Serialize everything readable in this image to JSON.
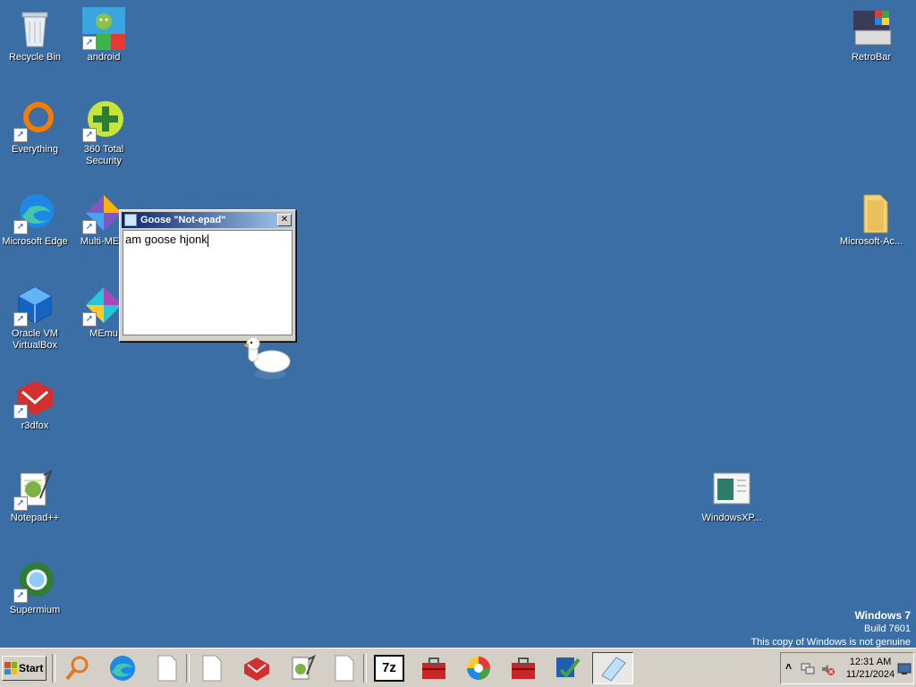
{
  "desktop": {
    "icons": [
      {
        "label": "Recycle Bin",
        "icon": "recycle-bin-icon"
      },
      {
        "label": "android",
        "icon": "android-icon"
      },
      {
        "label": "RetroBar",
        "icon": "retrobar-icon"
      },
      {
        "label": "Everything",
        "icon": "everything-icon"
      },
      {
        "label": "360 Total Security",
        "icon": "360-security-icon"
      },
      {
        "label": "Microsoft Edge",
        "icon": "edge-icon"
      },
      {
        "label": "Multi-ME...",
        "icon": "multi-memu-icon"
      },
      {
        "label": "Microsoft-Ac...",
        "icon": "folder-icon"
      },
      {
        "label": "Oracle VM VirtualBox",
        "icon": "virtualbox-icon"
      },
      {
        "label": "MEmu",
        "icon": "memu-icon"
      },
      {
        "label": "r3dfox",
        "icon": "r3dfox-icon"
      },
      {
        "label": "Notepad++",
        "icon": "notepadpp-icon"
      },
      {
        "label": "WindowsXP...",
        "icon": "windowsxp-file-icon"
      },
      {
        "label": "Supermium",
        "icon": "supermium-icon"
      }
    ]
  },
  "notepad": {
    "title": "Goose \"Not-epad\"",
    "text": "am goose hjonk",
    "close_glyph": "✕"
  },
  "watermark": {
    "line1": "Windows 7",
    "line2": "Build 7601",
    "line3": "This copy of Windows is not genuine"
  },
  "taskbar": {
    "start_label": "Start",
    "buttons": [
      "search-icon",
      "edge-icon",
      "blank-doc-icon",
      "blank-doc-icon",
      "r3dfox-icon",
      "notepadpp-icon",
      "blank-doc-icon",
      "7zip-icon",
      "toolbox-icon",
      "photos-icon",
      "toolbox-icon",
      "checklist-icon",
      "notepad-icon"
    ],
    "sevenzip_label": "7z",
    "clock": {
      "time": "12:31 AM",
      "date": "11/21/2024"
    },
    "tray_icons": [
      "chevron-up-icon",
      "network-icon",
      "volume-muted-icon",
      "show-desktop-icon"
    ],
    "chevron_glyph": "˄"
  }
}
